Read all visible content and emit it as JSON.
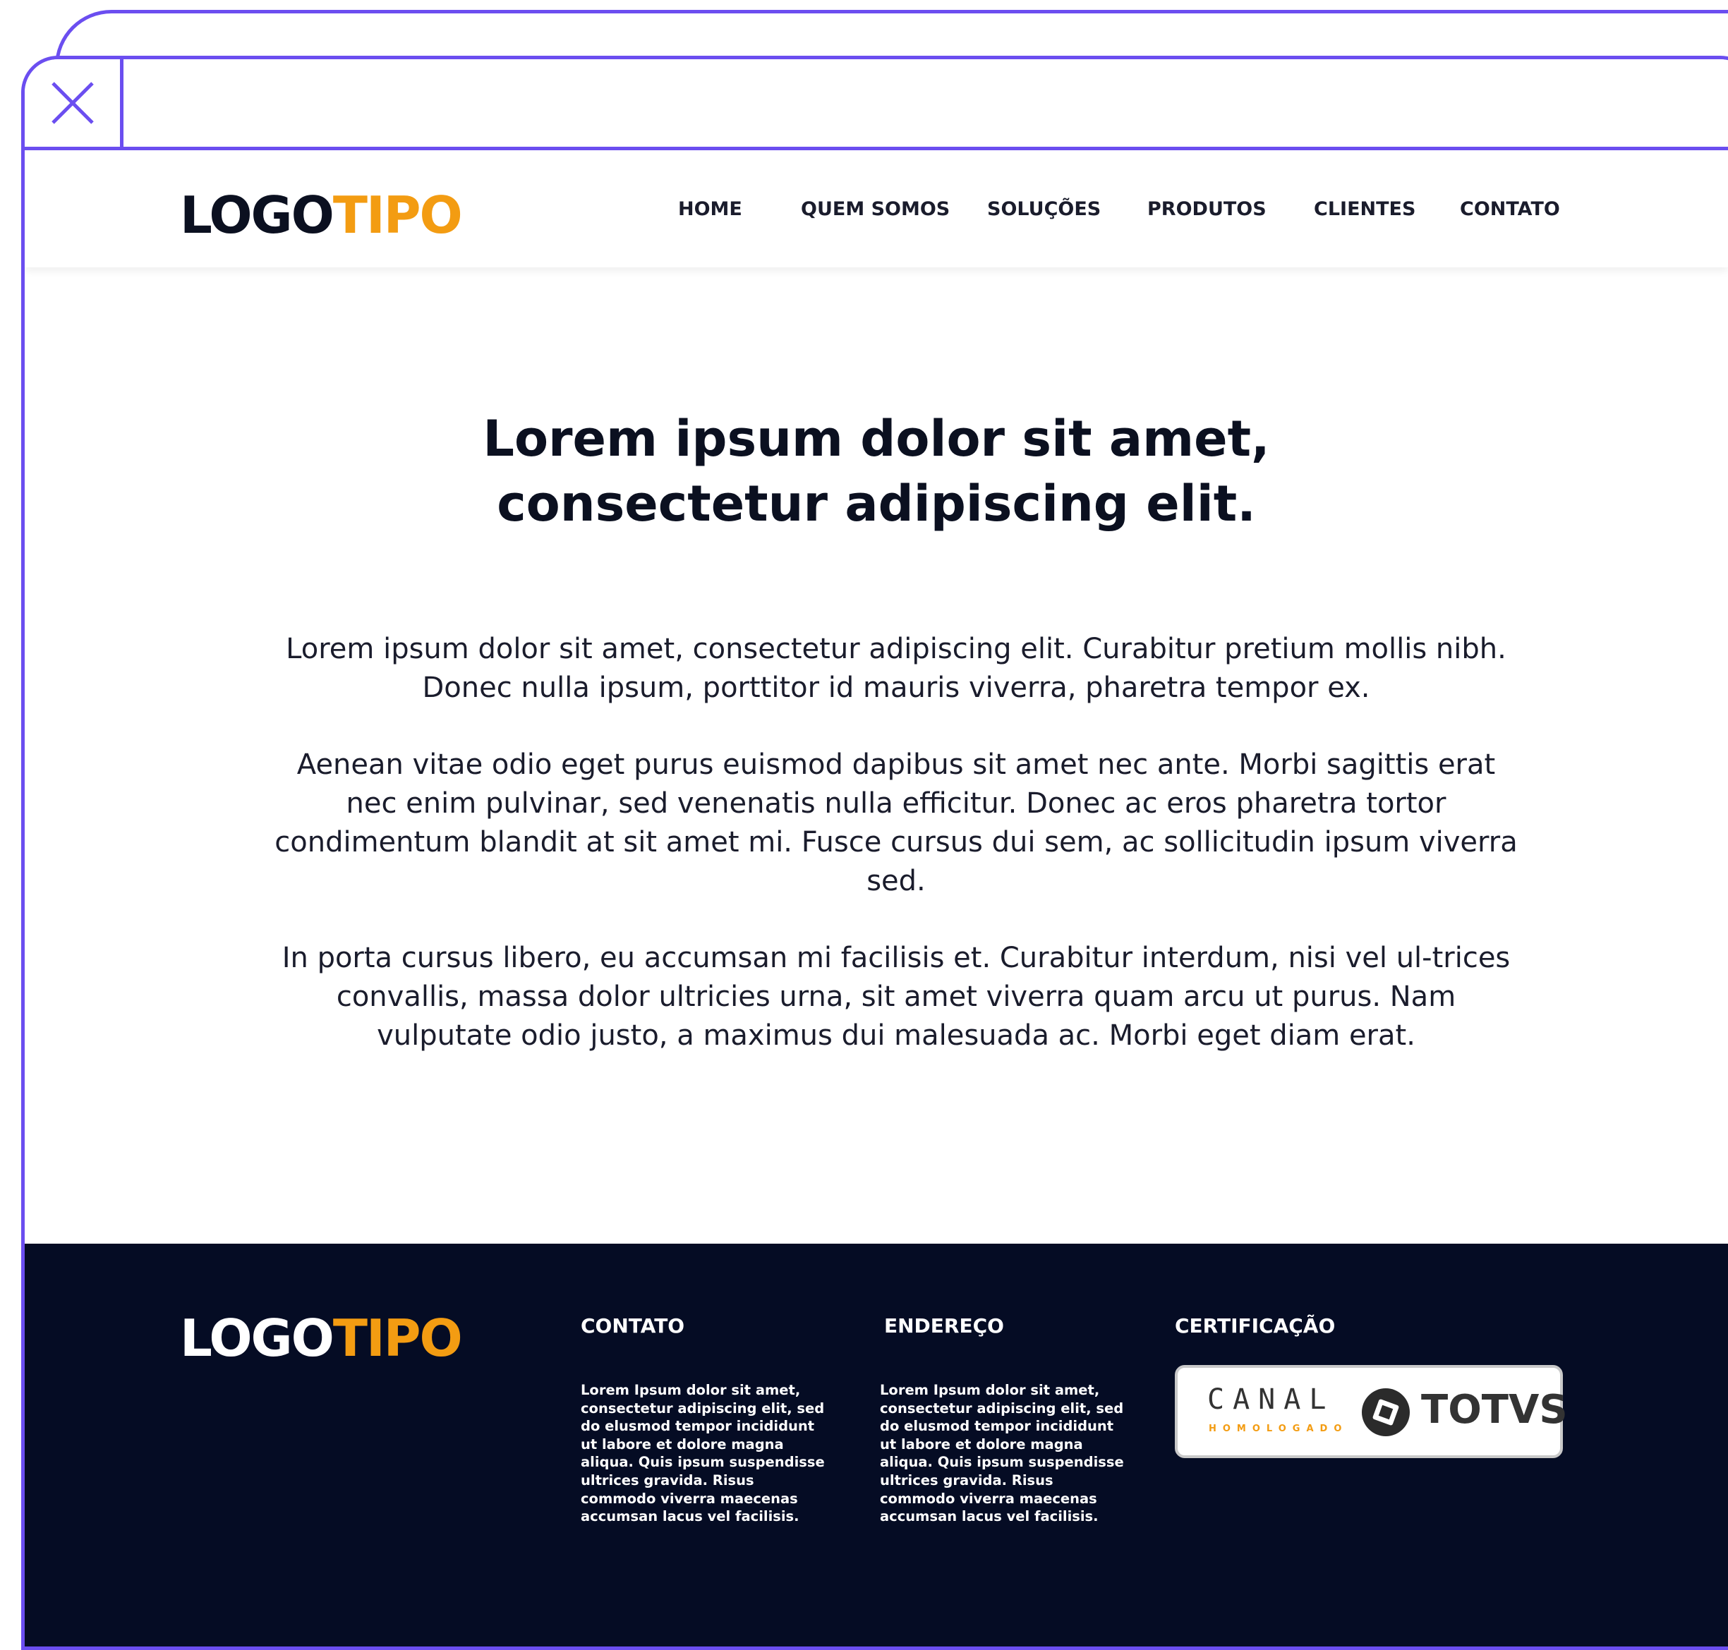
{
  "window": {
    "close_icon": "close-icon",
    "accent_color": "#6b4ef0"
  },
  "header": {
    "logo_part1": "LOGO",
    "logo_part2": "TIPO",
    "nav": [
      "HOME",
      "QUEM SOMOS",
      "SOLUÇÕES",
      "PRODUTOS",
      "CLIENTES",
      "CONTATO"
    ]
  },
  "main": {
    "title_line1": "Lorem ipsum dolor sit amet,",
    "title_line2": "consectetur adipiscing elit.",
    "paragraphs": [
      "Lorem ipsum dolor sit amet, consectetur adipiscing elit. Curabitur pretium mollis nibh. Donec nulla ipsum, porttitor id mauris viverra, pharetra tempor ex.",
      "Aenean vitae odio eget purus euismod dapibus sit amet nec ante. Morbi sagittis erat nec enim pulvinar, sed venenatis nulla efficitur. Donec ac eros pharetra tortor condimentum blandit at sit amet mi. Fusce cursus dui sem, ac sollicitudin ipsum viverra sed.",
      "In porta cursus libero, eu accumsan mi facilisis et. Curabitur interdum, nisi vel ul-trices convallis, massa dolor ultricies urna, sit amet viverra quam arcu ut purus. Nam vulputate odio justo, a maximus dui malesuada ac. Morbi eget diam erat."
    ]
  },
  "footer": {
    "logo_part1": "LOGO",
    "logo_part2": "TIPO",
    "contato_heading": "CONTATO",
    "contato_text": "Lorem Ipsum dolor sit amet, consectetur adipiscing elit, sed do elusmod tempor incididunt ut labore et dolore magna aliqua. Quis ipsum suspendisse ultrices gravida. Risus commodo viverra maecenas accumsan lacus vel facilisis.",
    "endereco_heading": "ENDEREÇO",
    "endereco_text": "Lorem Ipsum dolor sit amet, consectetur adipiscing elit, sed do elusmod tempor incididunt ut labore et dolore magna aliqua. Quis ipsum suspendisse ultrices gravida. Risus commodo viverra maecenas accumsan lacus vel facilisis.",
    "certificacao_heading": "CERTIFICAÇÃO",
    "badge": {
      "canal": "CANAL",
      "homologado": "HOMOLOGADO",
      "brand": "TOTVS",
      "brand_icon": "totvs-logo-icon"
    },
    "background_color": "#050c24"
  },
  "colors": {
    "logo_dark": "#0b1020",
    "logo_accent": "#f39c12",
    "frame": "#6b4ef0"
  }
}
